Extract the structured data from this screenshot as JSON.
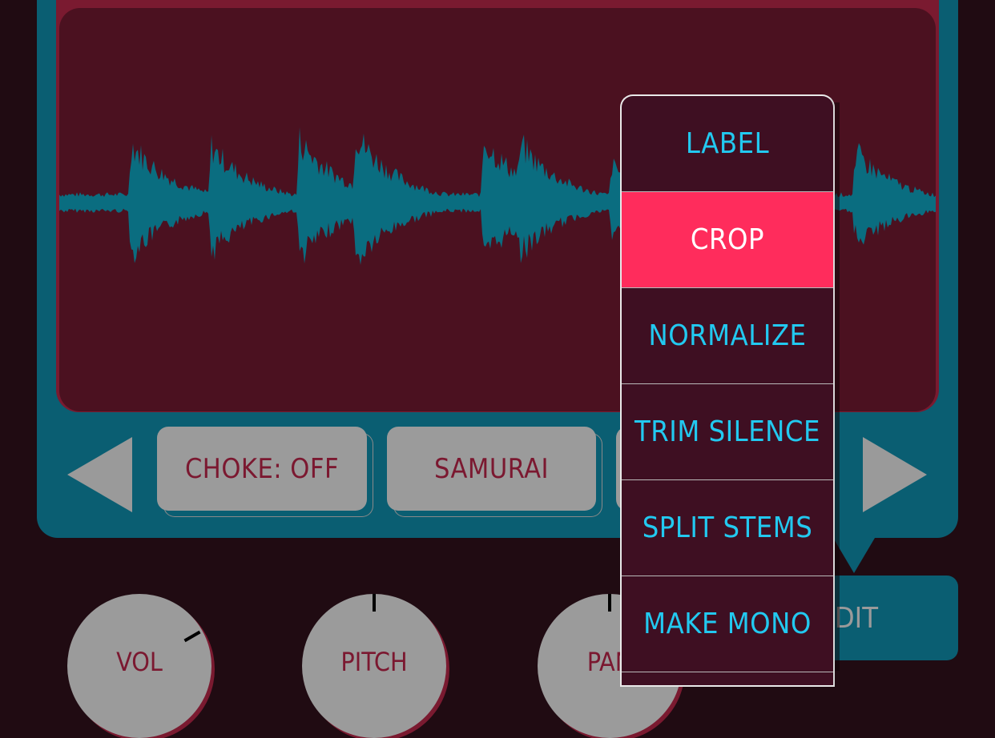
{
  "colors": {
    "background": "#200b12",
    "panel": "#0a5e72",
    "screen": "#4b1120",
    "waveform": "#0a6d80",
    "menu_bg": "#3e0f22",
    "menu_text": "#22c9f0",
    "menu_active": "#ff2c5c",
    "button_grey": "#9b9b9b",
    "button_text": "#7b1830"
  },
  "pad_buttons": {
    "choke": "CHOKE: OFF",
    "sample": "SAMURAI"
  },
  "nav": {
    "prev_icon": "triangle-left-icon",
    "next_icon": "triangle-right-icon"
  },
  "edit_button": {
    "label": "EDIT"
  },
  "knobs": [
    {
      "label": "VOL",
      "level": 0.7
    },
    {
      "label": "PITCH",
      "level": 0.5
    },
    {
      "label": "PAN",
      "level": 0.5
    }
  ],
  "menu": {
    "items": [
      "LABEL",
      "CROP",
      "NORMALIZE",
      "TRIM SILENCE",
      "SPLIT STEMS",
      "MAKE MONO"
    ],
    "active": "CROP"
  }
}
